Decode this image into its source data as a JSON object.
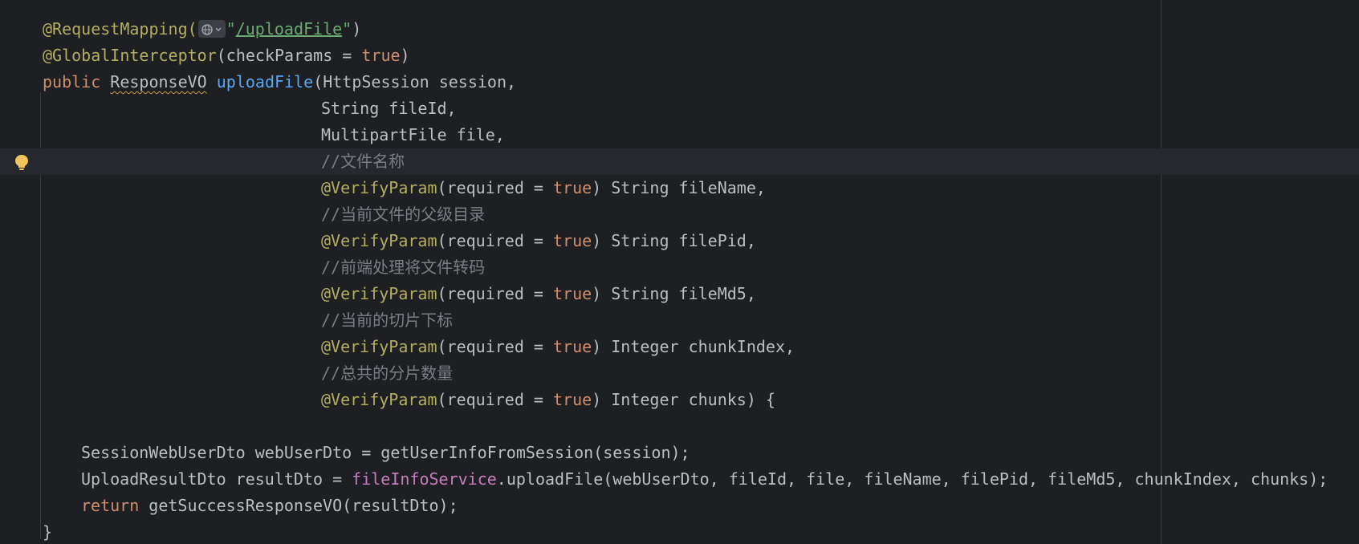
{
  "editor": {
    "lines": [
      {
        "segments": [
          {
            "text": "@RequestMapping(",
            "cls": "ann"
          },
          {
            "icon": "globe-icon"
          },
          {
            "text": "\"",
            "cls": "str"
          },
          {
            "text": "/uploadFile",
            "cls": "link"
          },
          {
            "text": "\"",
            "cls": "str"
          },
          {
            "text": ")",
            "cls": "plain"
          }
        ]
      },
      {
        "segments": [
          {
            "text": "@GlobalInterceptor",
            "cls": "ann"
          },
          {
            "text": "(checkParams = ",
            "cls": "plain"
          },
          {
            "text": "true",
            "cls": "kw"
          },
          {
            "text": ")",
            "cls": "plain"
          }
        ]
      },
      {
        "segments": [
          {
            "text": "public ",
            "cls": "kw"
          },
          {
            "text": "ResponseVO",
            "cls": "warn"
          },
          {
            "text": " ",
            "cls": "plain"
          },
          {
            "text": "uploadFile",
            "cls": "fn"
          },
          {
            "text": "(HttpSession session,",
            "cls": "plain"
          }
        ]
      },
      {
        "segments": [
          {
            "text": "String fileId,",
            "cls": "plain"
          }
        ]
      },
      {
        "segments": [
          {
            "text": "MultipartFile file,",
            "cls": "plain"
          }
        ]
      },
      {
        "segments": [
          {
            "text": "//文件名称",
            "cls": "cmt"
          }
        ]
      },
      {
        "segments": [
          {
            "text": "@VerifyParam",
            "cls": "ann"
          },
          {
            "text": "(required = ",
            "cls": "plain"
          },
          {
            "text": "true",
            "cls": "kw"
          },
          {
            "text": ") String fileName,",
            "cls": "plain"
          }
        ]
      },
      {
        "segments": [
          {
            "text": "//当前文件的父级目录",
            "cls": "cmt"
          }
        ]
      },
      {
        "segments": [
          {
            "text": "@VerifyParam",
            "cls": "ann"
          },
          {
            "text": "(required = ",
            "cls": "plain"
          },
          {
            "text": "true",
            "cls": "kw"
          },
          {
            "text": ") String filePid,",
            "cls": "plain"
          }
        ]
      },
      {
        "segments": [
          {
            "text": "//前端处理将文件转码",
            "cls": "cmt"
          }
        ]
      },
      {
        "segments": [
          {
            "text": "@VerifyParam",
            "cls": "ann"
          },
          {
            "text": "(required = ",
            "cls": "plain"
          },
          {
            "text": "true",
            "cls": "kw"
          },
          {
            "text": ") String fileMd5,",
            "cls": "plain"
          }
        ]
      },
      {
        "segments": [
          {
            "text": "//当前的切片下标",
            "cls": "cmt"
          }
        ]
      },
      {
        "segments": [
          {
            "text": "@VerifyParam",
            "cls": "ann"
          },
          {
            "text": "(required = ",
            "cls": "plain"
          },
          {
            "text": "true",
            "cls": "kw"
          },
          {
            "text": ") Integer chunkIndex,",
            "cls": "plain"
          }
        ]
      },
      {
        "segments": [
          {
            "text": "//总共的分片数量",
            "cls": "cmt"
          }
        ]
      },
      {
        "segments": [
          {
            "text": "@VerifyParam",
            "cls": "ann"
          },
          {
            "text": "(required = ",
            "cls": "plain"
          },
          {
            "text": "true",
            "cls": "kw"
          },
          {
            "text": ") Integer chunks) {",
            "cls": "plain"
          }
        ]
      },
      {
        "segments": []
      },
      {
        "segments": [
          {
            "text": "SessionWebUserDto webUserDto = getUserInfoFromSession(session);",
            "cls": "plain"
          }
        ]
      },
      {
        "segments": [
          {
            "text": "UploadResultDto resultDto = ",
            "cls": "plain"
          },
          {
            "text": "fileInfoService",
            "cls": "field"
          },
          {
            "text": ".uploadFile(webUserDto, fileId, file, fileName, filePid, fileMd5, chunkIndex, chunks);",
            "cls": "plain"
          }
        ]
      },
      {
        "segments": [
          {
            "text": "return ",
            "cls": "kw"
          },
          {
            "text": "getSuccessResponseVO(resultDto);",
            "cls": "plain"
          }
        ]
      },
      {
        "segments": [
          {
            "text": "}",
            "cls": "plain"
          }
        ]
      }
    ],
    "gutter_icon": "lightbulb-icon",
    "colors": {
      "background": "#1e1f22",
      "keyword": "#cf8e6d",
      "annotation": "#b3ae60",
      "function": "#56a8f5",
      "string": "#6aab73",
      "comment": "#7a7e85",
      "field": "#c77dbb",
      "text": "#bcbec4"
    }
  }
}
